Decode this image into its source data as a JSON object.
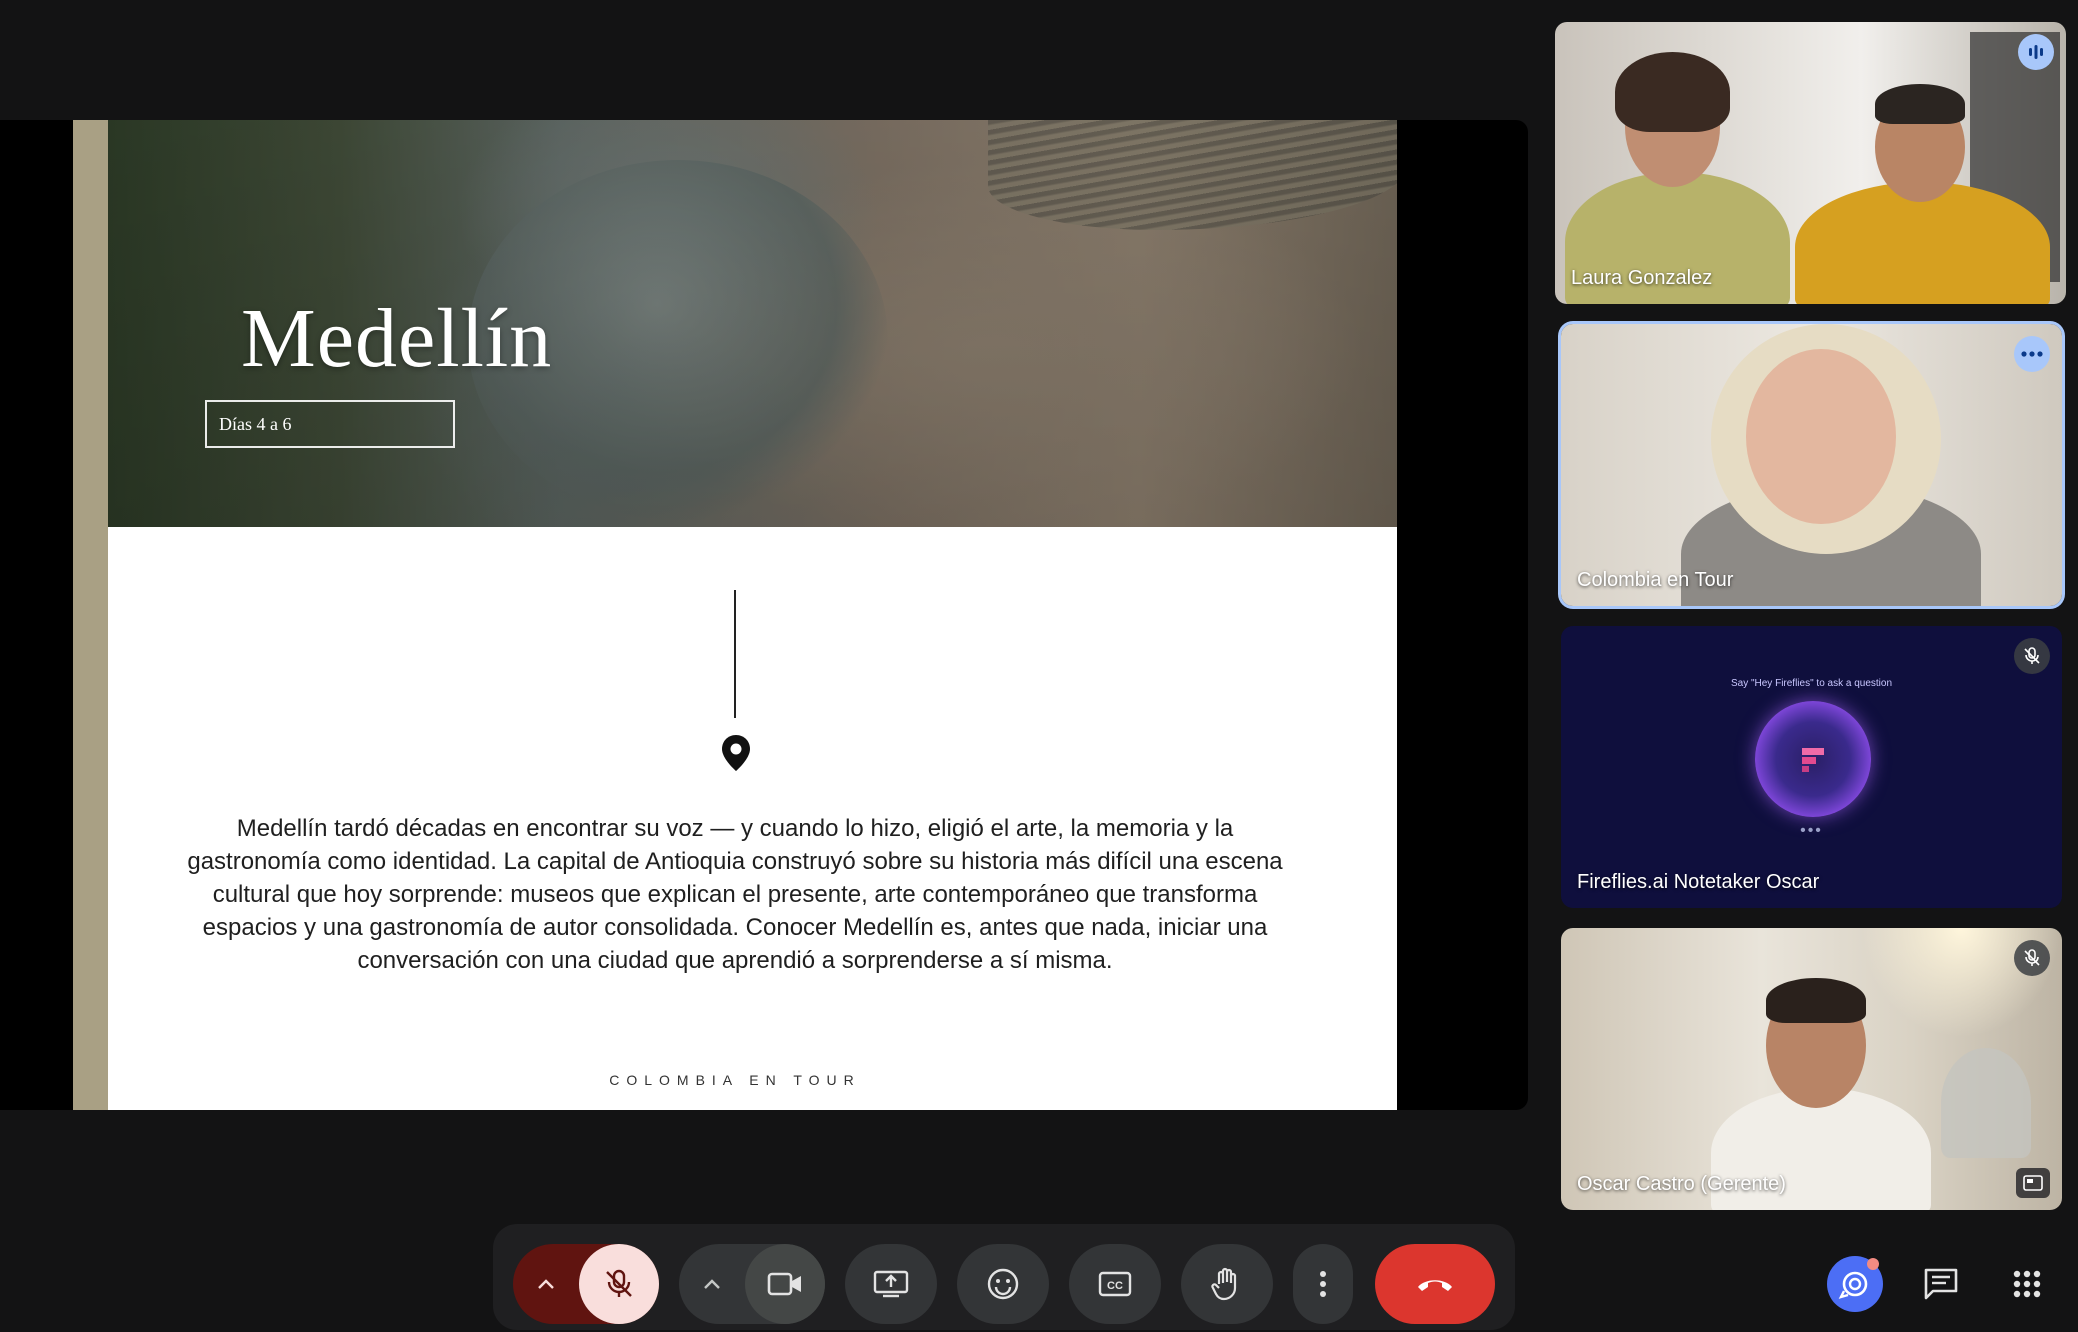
{
  "slide": {
    "title": "Medellín",
    "subtitle": "Días 4 a 6",
    "body": "Medellín tardó décadas en encontrar su voz — y cuando lo hizo, eligió el arte, la memoria y la gastronomía como identidad. La capital de Antioquia construyó sobre su historia más difícil una escena cultural que hoy sorprende: museos que explican el presente, arte contemporáneo que transforma espacios y una gastronomía de autor consolidada. Conocer Medellín es, antes que nada, iniciar una conversación con una ciudad que aprendió a sorprenderse a sí misma.",
    "footer": "COLOMBIA EN TOUR",
    "accent_color": "#a9a084"
  },
  "participants": [
    {
      "name": "Laura Gonzalez",
      "status_icon": "speaking-indicator-icon"
    },
    {
      "name": "Colombia en Tour",
      "status_icon": "more-options-icon",
      "active": true
    },
    {
      "name": "Fireflies.ai Notetaker Oscar",
      "status_icon": "mic-off-icon",
      "hint": "Say \"Hey Fireflies\" to ask a question",
      "dots": "•••"
    },
    {
      "name": "Oscar Castro (Gerente)",
      "status_icon": "mic-off-icon"
    }
  ],
  "controls": {
    "mic_state": "muted",
    "end_call_color": "#dc362e",
    "buttons": [
      "mic-options",
      "microphone",
      "camera-options",
      "camera",
      "present-screen",
      "reactions",
      "captions",
      "raise-hand",
      "more-options",
      "end-call"
    ]
  },
  "side_controls": [
    "activities",
    "chat",
    "apps"
  ]
}
